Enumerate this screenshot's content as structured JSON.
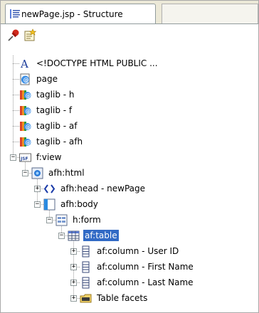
{
  "tab": {
    "title": "newPage.jsp - Structure",
    "icon": "structure-icon"
  },
  "toolbar": {
    "buttons": [
      {
        "name": "pin-button",
        "icon": "pushpin-icon"
      },
      {
        "name": "freeze-view-button",
        "icon": "freeze-view-icon"
      }
    ]
  },
  "tree": {
    "nodes": [
      {
        "label": "<!DOCTYPE HTML PUBLIC ...",
        "icon": "doctype-icon",
        "depth": 0
      },
      {
        "label": "page",
        "icon": "page-directive-icon",
        "depth": 0
      },
      {
        "label": "taglib - h",
        "icon": "taglib-icon",
        "depth": 0
      },
      {
        "label": "taglib - f",
        "icon": "taglib-icon",
        "depth": 0
      },
      {
        "label": "taglib - af",
        "icon": "taglib-icon",
        "depth": 0
      },
      {
        "label": "taglib - afh",
        "icon": "taglib-icon",
        "depth": 0
      },
      {
        "label": "f:view",
        "icon": "jsf-view-icon",
        "depth": 0,
        "expander": "−"
      },
      {
        "label": "afh:html",
        "icon": "html-element-icon",
        "depth": 1,
        "expander": "−"
      },
      {
        "label": "afh:head - newPage",
        "icon": "head-element-icon",
        "depth": 2,
        "expander": "+"
      },
      {
        "label": "afh:body",
        "icon": "body-element-icon",
        "depth": 2,
        "expander": "−"
      },
      {
        "label": "h:form",
        "icon": "form-icon",
        "depth": 3,
        "expander": "−"
      },
      {
        "label": "af:table",
        "icon": "table-icon",
        "depth": 4,
        "expander": "−",
        "selected": true
      },
      {
        "label": "af:column - User ID",
        "icon": "column-icon",
        "depth": 5,
        "expander": "+"
      },
      {
        "label": "af:column - First Name",
        "icon": "column-icon",
        "depth": 5,
        "expander": "+"
      },
      {
        "label": "af:column - Last Name",
        "icon": "column-icon",
        "depth": 5,
        "expander": "+"
      },
      {
        "label": "Table facets",
        "icon": "facets-folder-icon",
        "depth": 5,
        "expander": "+"
      }
    ]
  }
}
